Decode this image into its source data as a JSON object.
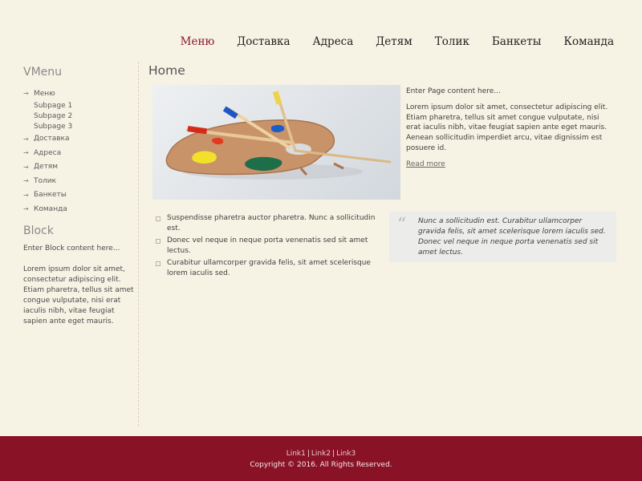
{
  "nav": {
    "items": [
      {
        "label": "Меню",
        "active": true
      },
      {
        "label": "Доставка"
      },
      {
        "label": "Адреса"
      },
      {
        "label": "Детям"
      },
      {
        "label": "Толик"
      },
      {
        "label": "Банкеты"
      },
      {
        "label": "Команда"
      }
    ]
  },
  "sidebar": {
    "vmenu_title": "VMenu",
    "vmenu": {
      "first": {
        "label": "Меню"
      },
      "subpages": [
        "Subpage 1",
        "Subpage 2",
        "Subpage 3"
      ],
      "items": [
        "Доставка",
        "Адреса",
        "Детям",
        "Толик",
        "Банкеты",
        "Команда"
      ]
    },
    "block_title": "Block",
    "block_intro": "Enter Block content here...",
    "block_body": "Lorem ipsum dolor sit amet, consectetur adipiscing elit. Etiam pharetra, tellus sit amet congue vulputate, nisi erat iaculis nibh, vitae feugiat sapien ante eget mauris."
  },
  "main": {
    "title": "Home",
    "intro": "Enter Page content here...",
    "body": "Lorem ipsum dolor sit amet, consectetur adipiscing elit. Etiam pharetra, tellus sit amet congue vulputate, nisi erat iaculis nibh, vitae feugiat sapien ante eget mauris. Aenean sollicitudin imperdiet arcu, vitae dignissim est posuere id.",
    "read_more": "Read more",
    "bullets": [
      "Suspendisse pharetra auctor pharetra. Nunc a sollicitudin est.",
      "Donec vel neque in neque porta venenatis sed sit amet lectus.",
      "Curabitur ullamcorper gravida felis, sit amet scelerisque lorem iaculis sed."
    ],
    "quote": "Nunc a sollicitudin est. Curabitur ullamcorper gravida felis, sit amet scelerisque lorem iaculis sed. Donec vel neque in neque porta venenatis sed sit amet lectus."
  },
  "footer": {
    "links": [
      "Link1",
      "Link2",
      "Link3"
    ],
    "copyright": "Copyright © 2016. All Rights Reserved."
  },
  "colors": {
    "background": "#f6f2e4",
    "accent": "#8b1b2e",
    "footer": "#8a1227"
  }
}
